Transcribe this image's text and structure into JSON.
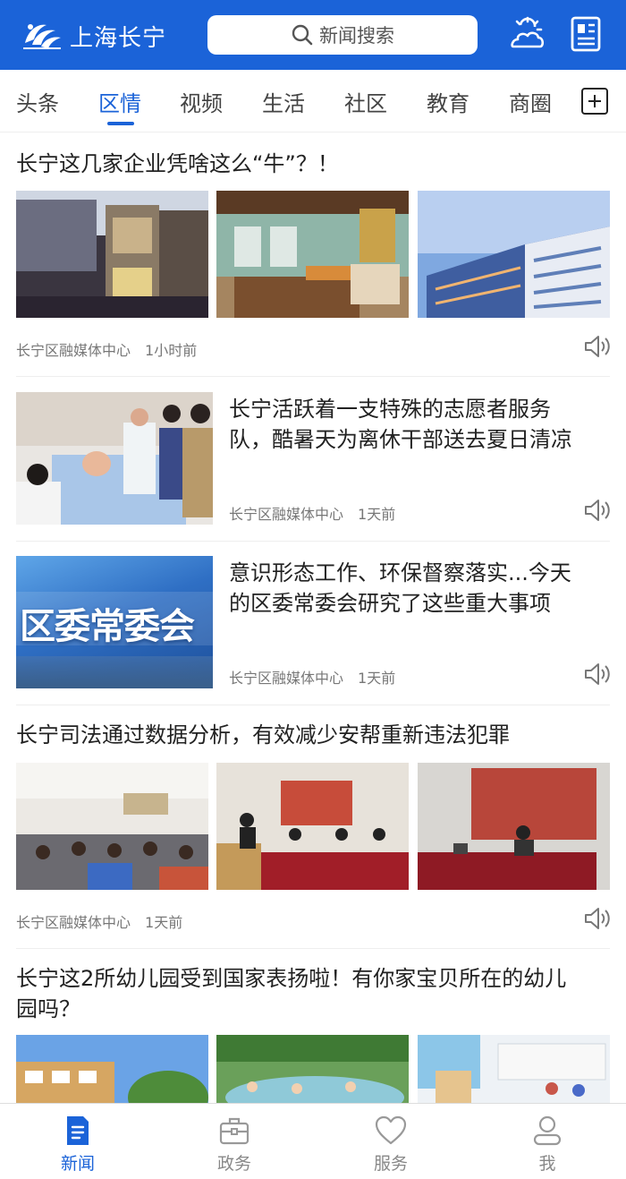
{
  "header": {
    "app_title": "上海长宁",
    "search_placeholder": "新闻搜索"
  },
  "tabs": [
    {
      "label": "头条"
    },
    {
      "label": "区情",
      "active": true
    },
    {
      "label": "视频"
    },
    {
      "label": "生活"
    },
    {
      "label": "社区"
    },
    {
      "label": "教育"
    },
    {
      "label": "商圈"
    }
  ],
  "articles": [
    {
      "title": "长宁这几家企业凭啥这么“牛”？！",
      "source": "长宁区融媒体中心",
      "time": "1小时前"
    },
    {
      "title_line1": "长宁活跃着一支特殊的志愿者服务",
      "title_line2": "队，酷暑天为离休干部送去夏日清凉",
      "source": "长宁区融媒体中心",
      "time": "1天前"
    },
    {
      "title_line1": "意识形态工作、环保督察落实...今天",
      "title_line2": "的区委常委会研究了这些重大事项",
      "image_text": "区委常委会",
      "source": "长宁区融媒体中心",
      "time": "1天前"
    },
    {
      "title": "长宁司法通过数据分析，有效减少安帮重新违法犯罪",
      "source": "长宁区融媒体中心",
      "time": "1天前"
    },
    {
      "title_line1": "长宁这2所幼儿园受到国家表扬啦！有你家宝贝所在的幼儿",
      "title_line2": "园吗？"
    }
  ],
  "tabbar": [
    {
      "label": "新闻",
      "icon": "news-doc-icon",
      "active": true
    },
    {
      "label": "政务",
      "icon": "briefcase-icon"
    },
    {
      "label": "服务",
      "icon": "heart-icon"
    },
    {
      "label": "我",
      "icon": "user-icon"
    }
  ],
  "colors": {
    "brand": "#1b63d8",
    "tab_active": "#1b63d8",
    "meta": "#777777"
  }
}
